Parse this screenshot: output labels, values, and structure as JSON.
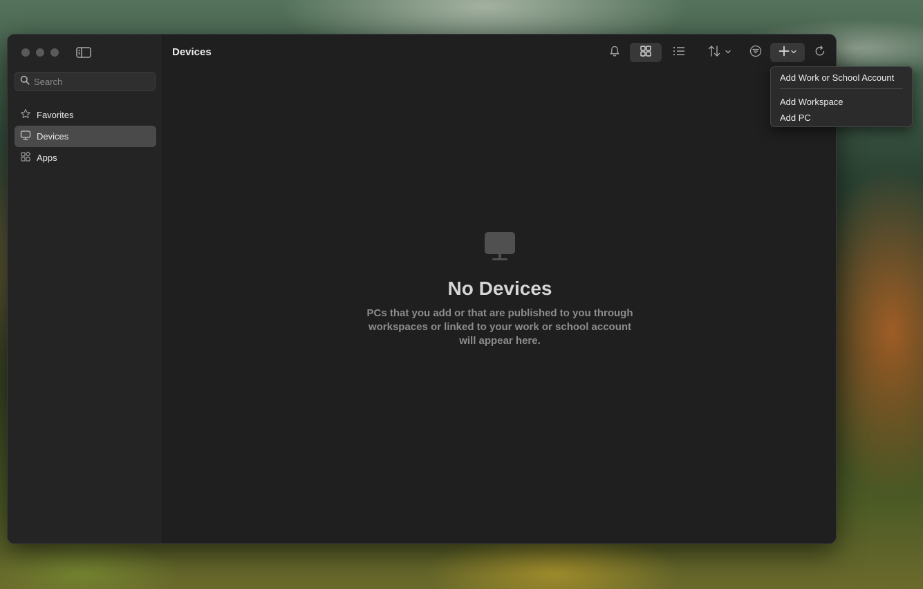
{
  "sidebar": {
    "search_placeholder": "Search",
    "items": [
      {
        "label": "Favorites",
        "icon": "star-icon",
        "active": false
      },
      {
        "label": "Devices",
        "icon": "monitor-icon",
        "active": true
      },
      {
        "label": "Apps",
        "icon": "apps-icon",
        "active": false
      }
    ]
  },
  "header": {
    "title": "Devices",
    "toolbar_icons": [
      "bell-icon",
      "grid-view-icon",
      "list-view-icon",
      "sort-icon",
      "filter-icon",
      "add-icon",
      "refresh-icon"
    ]
  },
  "empty_state": {
    "icon": "monitor-icon",
    "title": "No Devices",
    "description": "PCs that you add or that are published to you through workspaces or linked to your work or school account will appear here."
  },
  "add_menu": {
    "items": [
      "Add Work or School Account",
      "Add Workspace",
      "Add PC"
    ]
  },
  "colors": {
    "window_bg": "#1f1f1f",
    "sidebar_bg": "#242424",
    "active_item": "#4a4a4a",
    "menu_bg": "#2b2b2b"
  }
}
